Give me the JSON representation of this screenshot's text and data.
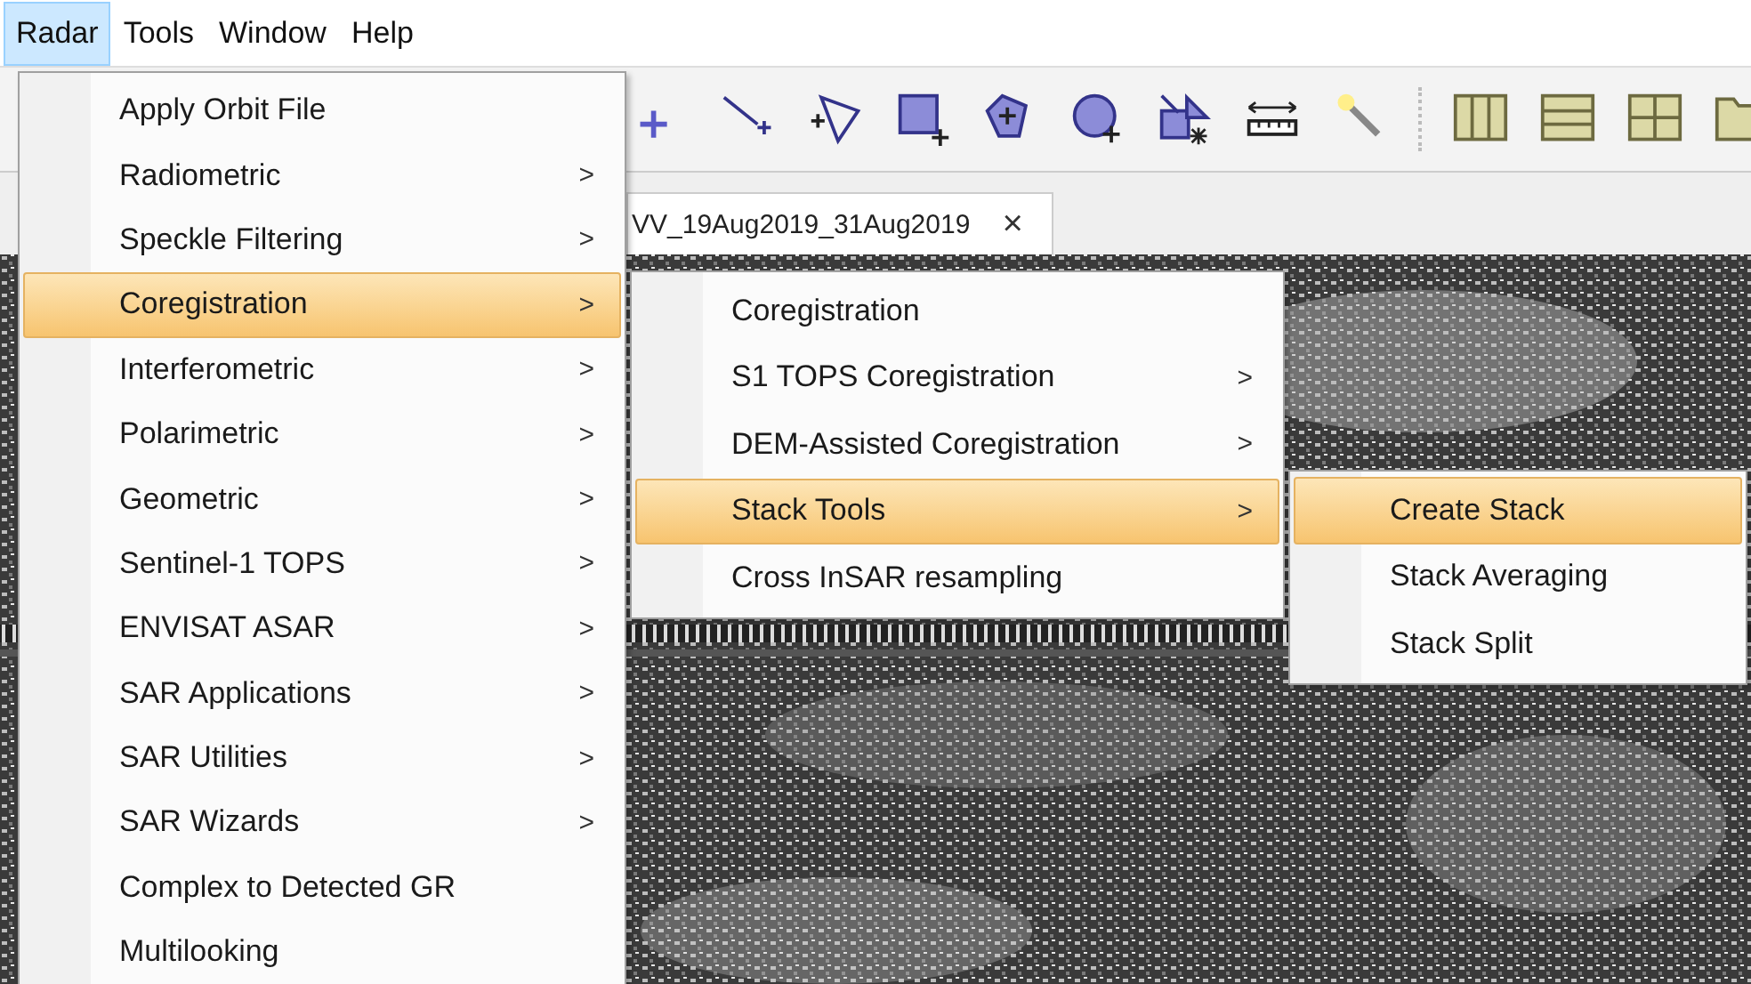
{
  "menubar": [
    {
      "label": "Radar",
      "selected": true
    },
    {
      "label": "Tools",
      "selected": false
    },
    {
      "label": "Window",
      "selected": false
    },
    {
      "label": "Help",
      "selected": false
    }
  ],
  "document_tab": {
    "label": "VV_19Aug2019_31Aug2019",
    "close": "×"
  },
  "menus": [
    {
      "items": [
        {
          "label": "Apply Orbit File",
          "selected": false
        },
        {
          "label": "Radiometric",
          "arrow": ">",
          "selected": false
        },
        {
          "label": "Speckle Filtering",
          "arrow": ">",
          "selected": false
        },
        {
          "label": "Coregistration",
          "arrow": ">",
          "selected": true
        },
        {
          "label": "Interferometric",
          "arrow": ">",
          "selected": false
        },
        {
          "label": "Polarimetric",
          "arrow": ">",
          "selected": false
        },
        {
          "label": "Geometric",
          "arrow": ">",
          "selected": false
        },
        {
          "label": "Sentinel-1 TOPS",
          "arrow": ">",
          "selected": false
        },
        {
          "label": "ENVISAT ASAR",
          "arrow": ">",
          "selected": false
        },
        {
          "label": "SAR Applications",
          "arrow": ">",
          "selected": false
        },
        {
          "label": "SAR Utilities",
          "arrow": ">",
          "selected": false
        },
        {
          "label": "SAR Wizards",
          "arrow": ">",
          "selected": false
        },
        {
          "label": "Complex to Detected GR",
          "selected": false
        },
        {
          "label": "Multilooking",
          "selected": false
        }
      ]
    },
    {
      "items": [
        {
          "label": "Coregistration",
          "selected": false
        },
        {
          "label": "S1 TOPS Coregistration",
          "arrow": ">",
          "selected": false
        },
        {
          "label": "DEM-Assisted Coregistration",
          "arrow": ">",
          "selected": false
        },
        {
          "label": "Stack Tools",
          "arrow": ">",
          "selected": true
        },
        {
          "label": "Cross InSAR resampling",
          "selected": false
        }
      ]
    },
    {
      "items": [
        {
          "label": "Create Stack",
          "selected": true
        },
        {
          "label": "Stack Averaging",
          "selected": false
        },
        {
          "label": "Stack Split",
          "selected": false
        }
      ]
    }
  ]
}
